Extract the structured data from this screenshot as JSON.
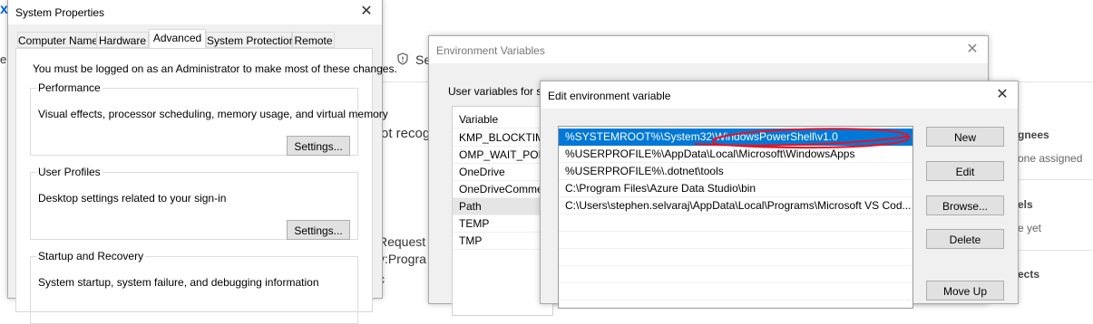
{
  "background": {
    "corner_letter": "x",
    "left_edge_text": "e",
    "settings_fragment": "Se",
    "lines": [
      "ot recog",
      "Request \"",
      "v:Progra",
      "c"
    ],
    "sidebar": [
      "gnees",
      "one assigned",
      "els",
      "e yet",
      "ects"
    ]
  },
  "system_properties": {
    "title": "System Properties",
    "tabs": [
      "Computer Name",
      "Hardware",
      "Advanced",
      "System Protection",
      "Remote"
    ],
    "active_tab": "Advanced",
    "admin_note": "You must be logged on as an Administrator to make most of these changes.",
    "performance": {
      "legend": "Performance",
      "text": "Visual effects, processor scheduling, memory usage, and virtual memory",
      "button": "Settings..."
    },
    "user_profiles": {
      "legend": "User Profiles",
      "text": "Desktop settings related to your sign-in",
      "button": "Settings..."
    },
    "startup": {
      "legend": "Startup and Recovery",
      "text": "System startup, system failure, and debugging information"
    }
  },
  "env_vars": {
    "title": "Environment Variables",
    "user_vars_label": "User variables for st",
    "column_header": "Variable",
    "variables": [
      "KMP_BLOCKTIME",
      "OMP_WAIT_POLI",
      "OneDrive",
      "OneDriveComme",
      "Path",
      "TEMP",
      "TMP"
    ],
    "selected": "Path"
  },
  "edit_env": {
    "title": "Edit environment variable",
    "entries": [
      "%SYSTEMROOT%\\System32\\WindowsPowerShell\\v1.0",
      "%USERPROFILE%\\AppData\\Local\\Microsoft\\WindowsApps",
      "%USERPROFILE%\\.dotnet\\tools",
      "C:\\Program Files\\Azure Data Studio\\bin",
      "C:\\Users\\stephen.selvaraj\\AppData\\Local\\Programs\\Microsoft VS Cod..."
    ],
    "selected_index": 0,
    "buttons": {
      "new": "New",
      "edit": "Edit",
      "browse": "Browse...",
      "delete": "Delete",
      "move_up": "Move Up"
    }
  },
  "colors": {
    "selection": "#0078d7",
    "annotation": "#e81123",
    "link": "#0366d6"
  }
}
